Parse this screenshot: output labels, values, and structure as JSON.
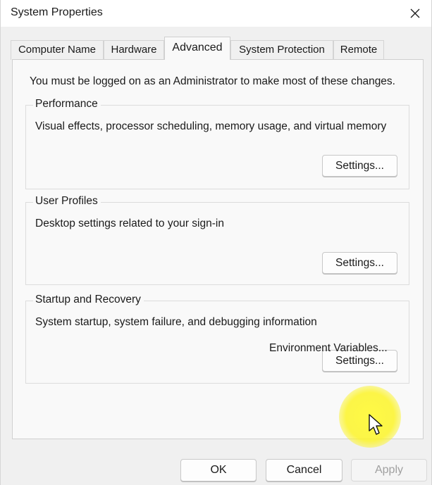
{
  "window": {
    "title": "System Properties",
    "close_icon": "close-icon"
  },
  "tabs": [
    {
      "label": "Computer Name",
      "active": false
    },
    {
      "label": "Hardware",
      "active": false
    },
    {
      "label": "Advanced",
      "active": true
    },
    {
      "label": "System Protection",
      "active": false
    },
    {
      "label": "Remote",
      "active": false
    }
  ],
  "advanced": {
    "admin_note": "You must be logged on as an Administrator to make most of these changes.",
    "groups": [
      {
        "title": "Performance",
        "description": "Visual effects, processor scheduling, memory usage, and virtual memory",
        "button_label": "Settings..."
      },
      {
        "title": "User Profiles",
        "description": "Desktop settings related to your sign-in",
        "button_label": "Settings..."
      },
      {
        "title": "Startup and Recovery",
        "description": "System startup, system failure, and debugging information",
        "button_label": "Settings..."
      }
    ],
    "env_vars_label": "Environment Variables..."
  },
  "footer": {
    "ok_label": "OK",
    "cancel_label": "Cancel",
    "apply_label": "Apply",
    "apply_enabled": false
  },
  "colors": {
    "window_bg": "#f0f0f0",
    "panel_bg": "#f9f9f9",
    "highlight": "#fcf428",
    "disabled_text": "#a0a0a0"
  }
}
